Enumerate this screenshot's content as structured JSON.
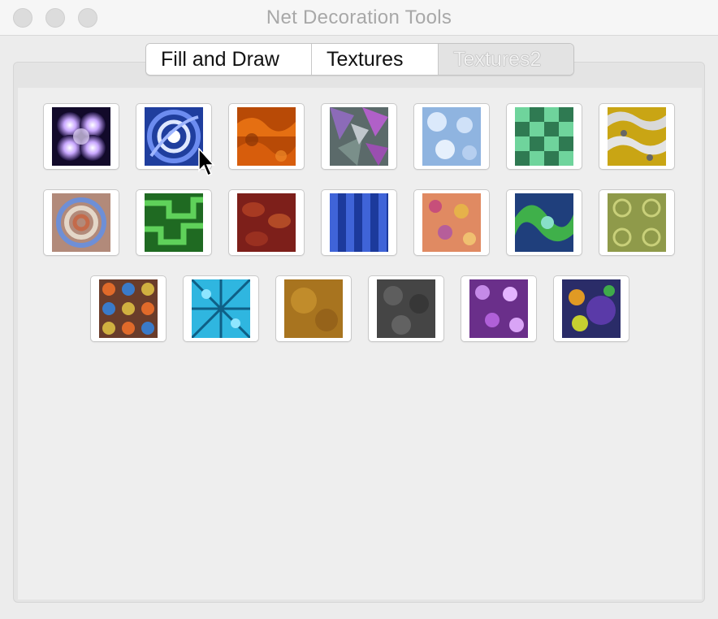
{
  "window": {
    "title": "Net Decoration Tools"
  },
  "tabs": [
    {
      "label": "Fill and Draw",
      "selected": false
    },
    {
      "label": "Textures",
      "selected": false
    },
    {
      "label": "Textures2",
      "selected": true
    }
  ],
  "textures": [
    [
      "purple-glow-texture",
      "blue-swirl-texture",
      "orange-flame-texture",
      "purple-crystal-texture",
      "ice-blue-texture",
      "green-checker-texture",
      "gold-silver-texture"
    ],
    [
      "rainbow-swirl-texture",
      "green-maze-texture",
      "red-leaf-texture",
      "blue-wave-texture",
      "orange-floral-texture",
      "green-marble-texture",
      "olive-pattern-texture"
    ],
    [
      "multicolor-quilt-texture",
      "cyan-star-texture",
      "golden-stucco-texture",
      "gray-stone-texture",
      "purple-gem-texture",
      "fruit-collage-texture"
    ]
  ]
}
